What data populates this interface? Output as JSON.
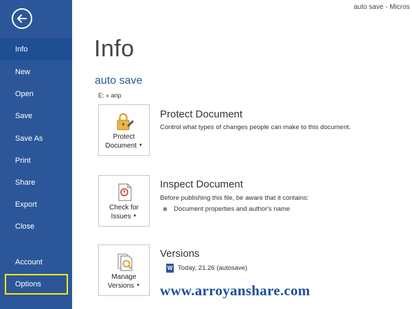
{
  "window": {
    "title": "auto save - Micros"
  },
  "sidebar": {
    "items": [
      {
        "label": "Info"
      },
      {
        "label": "New"
      },
      {
        "label": "Open"
      },
      {
        "label": "Save"
      },
      {
        "label": "Save As"
      },
      {
        "label": "Print"
      },
      {
        "label": "Share"
      },
      {
        "label": "Export"
      },
      {
        "label": "Close"
      },
      {
        "label": "Account"
      },
      {
        "label": "Options"
      }
    ],
    "active": "Info",
    "highlighted": "Options",
    "highlight_color": "#fbea10",
    "background_color": "#2b579a"
  },
  "main": {
    "page_title": "Info",
    "doc_name": "auto save",
    "doc_path": "E: » arip",
    "protect": {
      "button_line1": "Protect",
      "button_line2": "Document",
      "title": "Protect Document",
      "description": "Control what types of changes people can make to this document.",
      "icon": "lock-icon"
    },
    "inspect": {
      "button_line1": "Check for",
      "button_line2": "Issues",
      "title": "Inspect Document",
      "description": "Before publishing this file, be aware that it contains:",
      "bullets": [
        "Document properties and author's name"
      ],
      "icon": "inspect-document-icon"
    },
    "versions": {
      "button_line1": "Manage",
      "button_line2": "Versions",
      "title": "Versions",
      "entries": [
        "Today, 21.26 (autosave)"
      ],
      "icon": "manage-versions-icon"
    }
  },
  "watermark": "www.arroyanshare.com",
  "colors": {
    "accent": "#2b579a",
    "watermark": "#1c4f9c"
  }
}
